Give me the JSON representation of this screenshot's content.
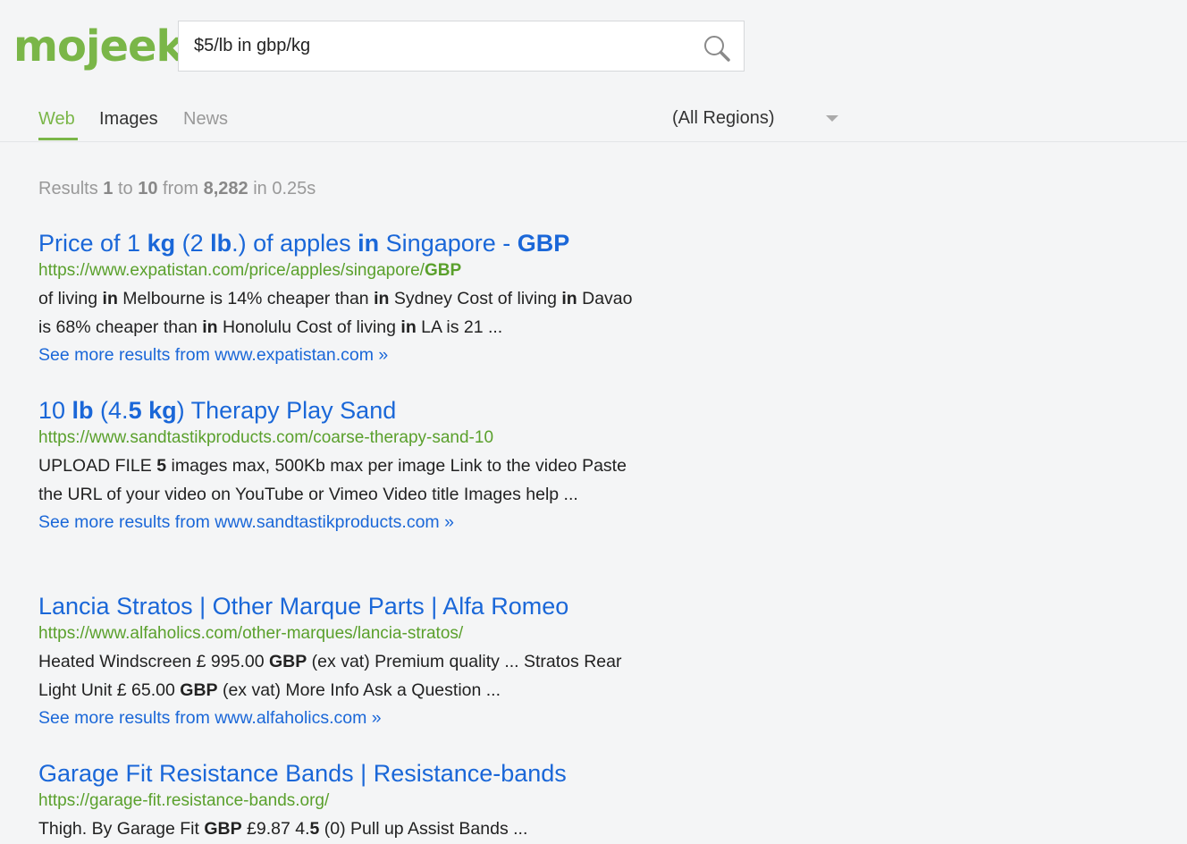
{
  "app": {
    "logo": "mojeek"
  },
  "search": {
    "query": "$5/lb in gbp/kg"
  },
  "tabs": {
    "web": "Web",
    "images": "Images",
    "news": "News"
  },
  "region": {
    "selected": "(All Regions)"
  },
  "results_meta": {
    "prefix": "Results",
    "start": "1",
    "to_word": "to",
    "end": "10",
    "from_word": "from",
    "total": "8,282",
    "in_word": "in",
    "time": "0.25s"
  },
  "results": [
    {
      "title": [
        {
          "t": "Price of 1 ",
          "b": false
        },
        {
          "t": "kg",
          "b": true
        },
        {
          "t": " (2 ",
          "b": false
        },
        {
          "t": "lb",
          "b": true
        },
        {
          "t": ".) of apples ",
          "b": false
        },
        {
          "t": "in",
          "b": true
        },
        {
          "t": " Singapore - ",
          "b": false
        },
        {
          "t": "GBP",
          "b": true
        }
      ],
      "url": [
        {
          "t": "https://www.expatistan.com/price/apples/singapore/",
          "b": false
        },
        {
          "t": "GBP",
          "b": true
        }
      ],
      "snippet": [
        {
          "t": "of living ",
          "b": false
        },
        {
          "t": "in",
          "b": true
        },
        {
          "t": " Melbourne is 14% cheaper than ",
          "b": false
        },
        {
          "t": "in",
          "b": true
        },
        {
          "t": " Sydney Cost of living ",
          "b": false
        },
        {
          "t": "in",
          "b": true
        },
        {
          "t": " Davao is 68% cheaper than ",
          "b": false
        },
        {
          "t": "in",
          "b": true
        },
        {
          "t": " Honolulu Cost of living ",
          "b": false
        },
        {
          "t": "in",
          "b": true
        },
        {
          "t": " LA is 21 ...",
          "b": false
        }
      ],
      "more": "See more results from www.expatistan.com »"
    },
    {
      "title": [
        {
          "t": "10 ",
          "b": false
        },
        {
          "t": "lb",
          "b": true
        },
        {
          "t": " (4.",
          "b": false
        },
        {
          "t": "5 kg",
          "b": true
        },
        {
          "t": ") Therapy Play Sand",
          "b": false
        }
      ],
      "url": [
        {
          "t": "https://www.sandtastikproducts.com/coarse-therapy-sand-10",
          "b": false
        }
      ],
      "snippet": [
        {
          "t": "UPLOAD FILE ",
          "b": false
        },
        {
          "t": "5",
          "b": true
        },
        {
          "t": " images max, 500Kb max per image Link to the video Paste the URL of your video on YouTube or Vimeo Video title Images help ...",
          "b": false
        }
      ],
      "more": "See more results from www.sandtastikproducts.com »"
    },
    {
      "title": [
        {
          "t": "Lancia Stratos | Other Marque Parts | Alfa Romeo",
          "b": false
        }
      ],
      "url": [
        {
          "t": "https://www.alfaholics.com/other-marques/lancia-stratos/",
          "b": false
        }
      ],
      "snippet": [
        {
          "t": "Heated Windscreen £ 995.00 ",
          "b": false
        },
        {
          "t": "GBP",
          "b": true
        },
        {
          "t": " (ex vat) Premium quality ... Stratos Rear Light Unit £ 65.00 ",
          "b": false
        },
        {
          "t": "GBP",
          "b": true
        },
        {
          "t": " (ex vat) More Info Ask a Question ...",
          "b": false
        }
      ],
      "more": "See more results from www.alfaholics.com »"
    },
    {
      "title": [
        {
          "t": "Garage Fit Resistance Bands | Resistance-bands",
          "b": false
        }
      ],
      "url": [
        {
          "t": "https://garage-fit.resistance-bands.org/",
          "b": false
        }
      ],
      "snippet": [
        {
          "t": "Thigh. By Garage Fit ",
          "b": false
        },
        {
          "t": "GBP",
          "b": true
        },
        {
          "t": " £9.87 4.",
          "b": false
        },
        {
          "t": "5",
          "b": true
        },
        {
          "t": " (0) Pull up Assist Bands ...",
          "b": false
        }
      ],
      "more": ""
    }
  ],
  "colors": {
    "background": "#f4f5f6",
    "brand_green": "#7ab648",
    "link_blue": "#1a67d8",
    "url_green": "#5aa02c",
    "meta_gray": "#999999"
  },
  "icons": {
    "search": "search-icon",
    "region_dropdown": "chevron-down-icon"
  }
}
